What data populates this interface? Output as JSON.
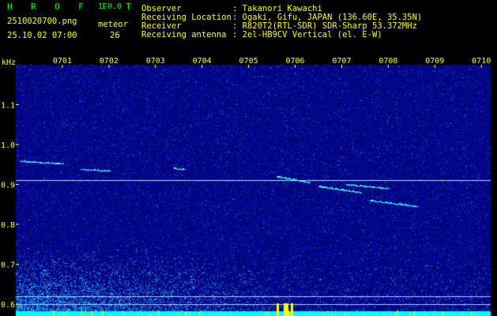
{
  "header": {
    "app_name": "H R O F F T",
    "app_version": "1.0.0",
    "filename": "2510020700.png",
    "datetime": "25.10.02 07:00",
    "meteor_label": "meteor",
    "meteor_count": "26",
    "info": [
      {
        "key": "Observer",
        "value": ": Takanori Kawachi"
      },
      {
        "key": "Receiving Location",
        "value": ": Ogaki, Gifu, JAPAN (136.60E, 35.35N)"
      },
      {
        "key": "Receiver",
        "value": ": R820T2(RTL-SDR) SDR-Sharp 53.372MHz"
      },
      {
        "key": "Receiving antenna",
        "value": ": 2el-HB9CV Vertical (el. E-W)"
      }
    ]
  },
  "colors": {
    "background": "#000000",
    "plot_noise": "#00008c",
    "tick": "#ffff00",
    "trace": "#00ffff",
    "carrier": "#9fe8ff",
    "bottom_band": "#00ffff",
    "bottom_spikes": "#ffff00"
  },
  "chart_data": {
    "type": "heatmap",
    "ylabel": "kHz",
    "x_tick_labels": [
      "0701",
      "0702",
      "0703",
      "0704",
      "0705",
      "0706",
      "0707",
      "0708",
      "0709",
      "0710"
    ],
    "x_ticks_min": [
      1,
      2,
      3,
      4,
      5,
      6,
      7,
      8,
      9,
      10
    ],
    "xlim_min": [
      0,
      10.2
    ],
    "y_tick_labels": [
      "1.1",
      "1.0",
      "0.9",
      "0.8",
      "0.7",
      "0.6"
    ],
    "y_ticks_khz": [
      1.1,
      1.0,
      0.9,
      0.8,
      0.7,
      0.6
    ],
    "ylim_khz": [
      0.57,
      1.2
    ],
    "carrier_lines_khz": [
      0.91,
      0.62,
      0.6
    ],
    "echoes": [
      {
        "t0": 0.1,
        "t1": 1.0,
        "f0": 0.958,
        "f1": 0.952
      },
      {
        "t0": 1.4,
        "t1": 2.0,
        "f0": 0.938,
        "f1": 0.934
      },
      {
        "t0": 3.4,
        "t1": 3.6,
        "f0": 0.94,
        "f1": 0.938
      },
      {
        "t0": 5.6,
        "t1": 6.3,
        "f0": 0.92,
        "f1": 0.905
      },
      {
        "t0": 6.5,
        "t1": 7.4,
        "f0": 0.895,
        "f1": 0.88
      },
      {
        "t0": 7.1,
        "t1": 8.0,
        "f0": 0.9,
        "f1": 0.89
      },
      {
        "t0": 7.6,
        "t1": 8.6,
        "f0": 0.86,
        "f1": 0.845
      }
    ]
  }
}
